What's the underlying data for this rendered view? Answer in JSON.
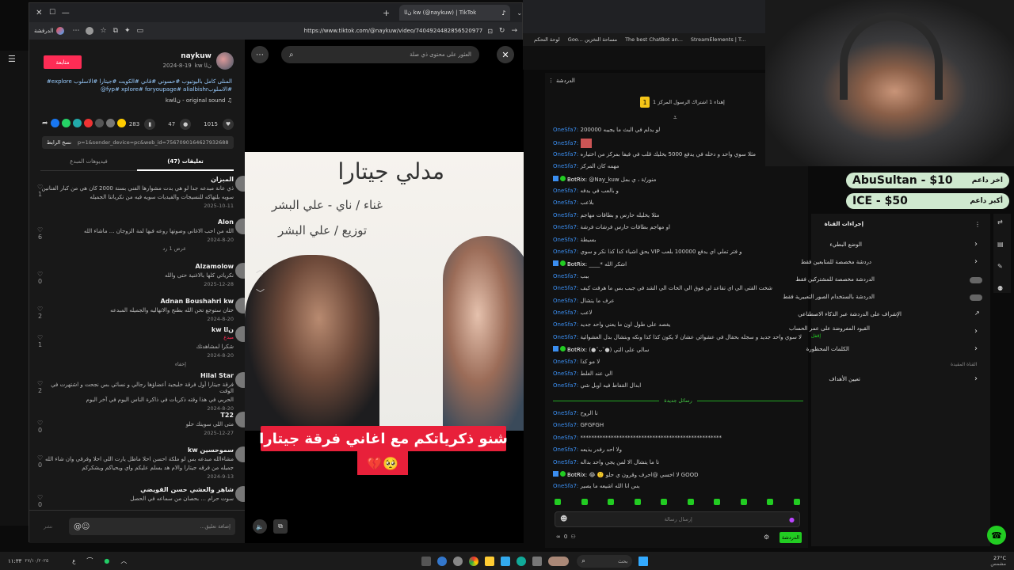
{
  "browser": {
    "tab_title": "ﻥﺍﺎ kw (@naykuw) | TikTok",
    "url": "https://www.tiktok.com/@naykuw/video/7404924482856520977",
    "app_label": "الدرفشة"
  },
  "bookmarks": [
    "لوحة التحكم",
    "Goo... مساحة التخزين",
    "The best ChatBot an...",
    "StreamElements | T..."
  ],
  "post": {
    "follow": "متابعة",
    "author": "naykuw",
    "author_sub": "ﻥﺍﺎ kw",
    "date": "2024-8-19",
    "caption": "المنلى كامل باليوتيوب #حسوني #ﻗﺎﻧﻲ #الكويت #جيتارا #الاسلوب explore# #الاسلوبfyp# xplore# foryoupage# alialbishr@",
    "sound": "original sound - ﻥﺍﺎkw",
    "stats": {
      "likes": "1015",
      "comments": "47",
      "saves": "283"
    },
    "link": "p=1&sender_device=pc&web_id=7567090164627932688",
    "copy_label": "نسخ الرابط"
  },
  "tabs": {
    "comments": "تعليقات (47)",
    "related": "فيديوهات المبدع"
  },
  "comments": [
    {
      "name": "المبزان",
      "text": "ذي ﻋﺎﻧﺔ مبدعه جدا لو هي بدت مشوارها الفني بسنة 2000 كان هي من كبار الفنانين",
      "text2": "سويه بلتهاكه للنسيجات والفيديات سويه فيه من نكرياتنا الجميله",
      "date": "2025-10-11",
      "likes": "1"
    },
    {
      "name": "Alon",
      "text": "الله من احب الاغاني وصوتها روعه فيها لمة الزوجان ... ماشاء الله",
      "date": "2024-8-20",
      "likes": "6",
      "replies": "عرض 1 رد"
    },
    {
      "name": "Alzamolow",
      "text": "نكرياتي كلها بالاغنية حتى والله",
      "date": "2025-12-28",
      "likes": "0"
    },
    {
      "name": "Adnan Boushahri kw",
      "text": "حتان ستوجع تحن الله بطنج والاتهاليه والجميله المبدعه",
      "date": "2024-8-20",
      "likes": "2"
    },
    {
      "name": "ﻥﺍﺎ kw",
      "badge": "مبدع",
      "text": "شكرا لمشاهدتك",
      "date": "2024-8-20",
      "likes": "1",
      "replies": "إخفاء"
    },
    {
      "name": "Hilal Star",
      "text": "فرقة جيتارا أول فرقة خليجية أعضاؤها رجالي و نسائي بس نجحت و اشتهرت في الوقت",
      "text2": "الحربي في هذا وقته ذكريات في ذاكرة الناس اليوم في آخر اليوم",
      "date": "2024-8-20",
      "likes": "2"
    },
    {
      "name": "T22",
      "text": "متى اللي سوينك حلو",
      "date": "2025-12-27",
      "likes": "0"
    },
    {
      "name": "سموحسين kw",
      "text": "مشاءالله مبدعه بس لو ملكة احسن احلا ماظل يارت اللي احلا وفرقي وان شاء الله",
      "text2": "جميله من فرقه جيتارا والام هد يسلم عليكم واي ويحياكم ويشكركم",
      "date": "2024-9-13",
      "likes": "0"
    },
    {
      "name": "شاهر والعشي حسن القويضي",
      "text": "سوت حرام ... بحصان من سماعه في الحصل",
      "date": "",
      "likes": "0"
    }
  ],
  "comment_box": {
    "placeholder": "إضافة تعليق...",
    "post": "نشر"
  },
  "video": {
    "search_placeholder": "العثور على محتوى ذي صلة",
    "title": "مدلي جيتارا",
    "line1": "غناء / ناي - علي البشر",
    "line2": "توزيع / علي البشر",
    "caption": "شنو ذكرياتكم مع اغاني فرقة جيتارا",
    "emoji": "💔🥺"
  },
  "chat": {
    "header": "الدردشة",
    "pinned": "إهداء 1 اشتراك الرسول المركز 1",
    "msgs": [
      [
        "OneSfa7:",
        "200000 لو يدلم في البث ما يجيبه"
      ],
      [
        "OneSfa7:",
        ""
      ],
      [
        "OneSfa7:",
        "مثلا سوي واحد و دخله في يدفع 5000 يخليك قلب في فيفا بمركز من اختياره"
      ],
      [
        "OneSfa7:",
        "مهمه كان المركز"
      ],
      [
        "BotRix:",
        "@Nay_kuw منور/ة ، ي بمل"
      ],
      [
        "OneSfa7:",
        "و بالعب في يدفه"
      ],
      [
        "OneSfa7:",
        "بلاعب"
      ],
      [
        "OneSfa7:",
        "مثلا يخليله حارس و بطاقات مهاجم"
      ],
      [
        "OneSfa7:",
        "او مهاجم بطاقات حارس فرشات فرشة"
      ],
      [
        "OneSfa7:",
        "بسيطة"
      ],
      [
        "OneSfa7:",
        "يحق اشياء كذا كذا نكر و سوي VIP و فتر تملي اي يدفع 100000 بلعب"
      ],
      [
        "BotRix:",
        "____* اشكر الله"
      ],
      [
        "OneSfa7:",
        "ببب"
      ],
      [
        "OneSfa7:",
        "شخت القتي الي اي تقاعد لي فوق الي الحات الي الشد في جيب بس ما هرفت كيف"
      ],
      [
        "OneSfa7:",
        "عرف ما يتشال"
      ],
      [
        "OneSfa7:",
        "لاعب"
      ],
      [
        "OneSfa7:",
        "يغصد على طول اون ما يعني واحد جديد"
      ],
      [
        "OneSfa7:",
        "لا سوي واحد جديد و سجله بحقال في عشوائي عشان لا يكون كذا كذا ونكه وبتشال بدل العشوائية"
      ],
      [
        "BotRix:",
        "(●˘ᴗ˘●) سالي على التي"
      ],
      [
        "OneSfa7:",
        "لا مو كذا"
      ],
      [
        "OneSfa7:",
        "الي عند الغلط"
      ],
      [
        "OneSfa7:",
        "ابدال القفاط فيه اوبل شي"
      ]
    ],
    "new_msgs": "رسائل جديدة",
    "msgs2": [
      [
        "OneSfa7:",
        "تا الروح"
      ],
      [
        "OneSfa7:",
        "GFGFGH"
      ],
      [
        "OneSfa7:",
        "***************************************************"
      ],
      [
        "OneSfa7:",
        "ولا احد رفدر يذيعه"
      ],
      [
        "OneSfa7:",
        "تا ما يتشال الا لمن يجي واحد بداله"
      ],
      [
        "BotRix:",
        "😂 🙂 لا اخسي @احرف وقرون ي حلو GOOD"
      ],
      [
        "OneSfa7:",
        "يس انا الله اشيعه ما يصير"
      ]
    ],
    "input_placeholder": "إرسال رسالة",
    "send": "الدردشة",
    "viewers": "0"
  },
  "donors": [
    {
      "label": "اخر داعم",
      "value": "AbuSultan - $10"
    },
    {
      "label": "أكبر داعم",
      "value": "ICE - $50"
    }
  ],
  "settings": {
    "title": "إجراءات القناة",
    "items": [
      "الوضع البطيء",
      "دردشة مخصصة للمتابعين فقط",
      "الدردشة مخصصة للمشتركين فقط",
      "الدردشة بالستخدام الصور التعبيرية فقط",
      "الإشراف على الدردشة عبر الذكاء الاصطناعي",
      "القيود المفروضة على عمر الحساب",
      "الكلمات المحظورة"
    ],
    "note": "إقفل",
    "hint": "القناة المقيدة",
    "goals": "تعيين الأهداف"
  },
  "taskbar": {
    "search": "بحث",
    "time": "27°C",
    "weather": "مشمس",
    "clock": "١١:٣٣",
    "date": "٢٧/١٠/٢٠٢٥"
  }
}
